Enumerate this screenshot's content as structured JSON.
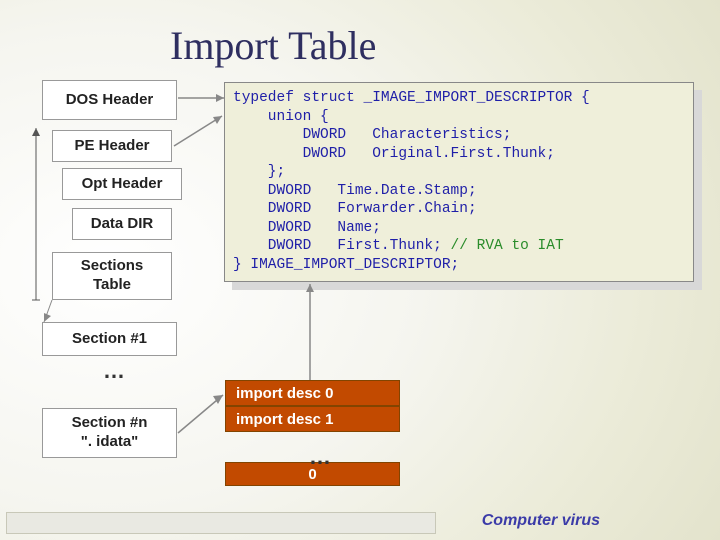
{
  "title": "Import Table",
  "pe_layout": {
    "dos_header": "DOS Header",
    "pe_header": "PE Header",
    "opt_header": "Opt Header",
    "data_dir": "Data DIR",
    "sections_table": "Sections\nTable",
    "section_1": "Section #1",
    "section_n": "Section #n\n\". idata\""
  },
  "vdots": "…",
  "code": {
    "lines": [
      "typedef struct _IMAGE_IMPORT_DESCRIPTOR {",
      "    union {",
      "        DWORD   Characteristics;",
      "        DWORD   Original.First.Thunk;",
      "    };",
      "    DWORD   Time.Date.Stamp;",
      "    DWORD   Forwarder.Chain;",
      "    DWORD   Name;",
      "    DWORD   First.Thunk; ",
      "} IMAGE_IMPORT_DESCRIPTOR;"
    ],
    "comment": "// RVA to IAT"
  },
  "import_table": {
    "rows": [
      "import desc 0",
      "import desc 1"
    ],
    "terminator": "0"
  },
  "footer": "Computer virus"
}
